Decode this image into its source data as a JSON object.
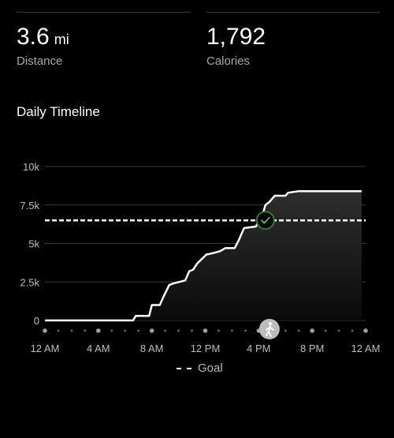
{
  "stats": {
    "distance": {
      "value": "3.6",
      "unit": "mi",
      "label": "Distance"
    },
    "calories": {
      "value": "1,792",
      "label": "Calories"
    }
  },
  "section_title": "Daily Timeline",
  "legend": {
    "goal_label": "Goal"
  },
  "colors": {
    "background": "#000000",
    "line": "#ffffff",
    "gridline": "#3a3a3a",
    "goal_check": "#2e7d32",
    "walk_marker": "#bdbdbd"
  },
  "icons": {
    "goal_reached": "check-circle-icon",
    "activity": "walking-person-icon"
  },
  "chart_data": {
    "type": "area",
    "y_tick_labels": [
      "10k",
      "7.5k",
      "5k",
      "2.5k",
      "0"
    ],
    "y_ticks": [
      10000,
      7500,
      5000,
      2500,
      0
    ],
    "ylim": [
      0,
      10000
    ],
    "x_tick_labels": [
      "12 AM",
      "4 AM",
      "8 AM",
      "12 PM",
      "4 PM",
      "8 PM",
      "12 AM"
    ],
    "xlim": [
      0,
      24
    ],
    "goal": 6500,
    "goal_reached_at_hour": 16.5,
    "activity_marker_hour": 16.8,
    "series": [
      {
        "x": [
          0,
          6.6,
          6.8,
          7.8,
          8.0,
          8.6,
          8.8,
          9.3,
          9.6,
          10.5,
          10.8,
          11.1,
          11.4,
          12.1,
          12.2,
          12.7,
          13.1,
          13.5,
          14.2,
          14.5,
          14.9,
          15.8,
          16.0,
          16.3,
          16.5,
          16.8,
          17.2,
          18.0,
          18.2,
          19.0,
          23.7
        ],
        "y": [
          0,
          0,
          300,
          300,
          1000,
          1000,
          1400,
          2300,
          2400,
          2600,
          3200,
          3300,
          3700,
          4300,
          4300,
          4400,
          4500,
          4700,
          4700,
          5200,
          6000,
          6100,
          6500,
          6900,
          7500,
          7700,
          8100,
          8100,
          8300,
          8400,
          8400
        ]
      }
    ]
  }
}
